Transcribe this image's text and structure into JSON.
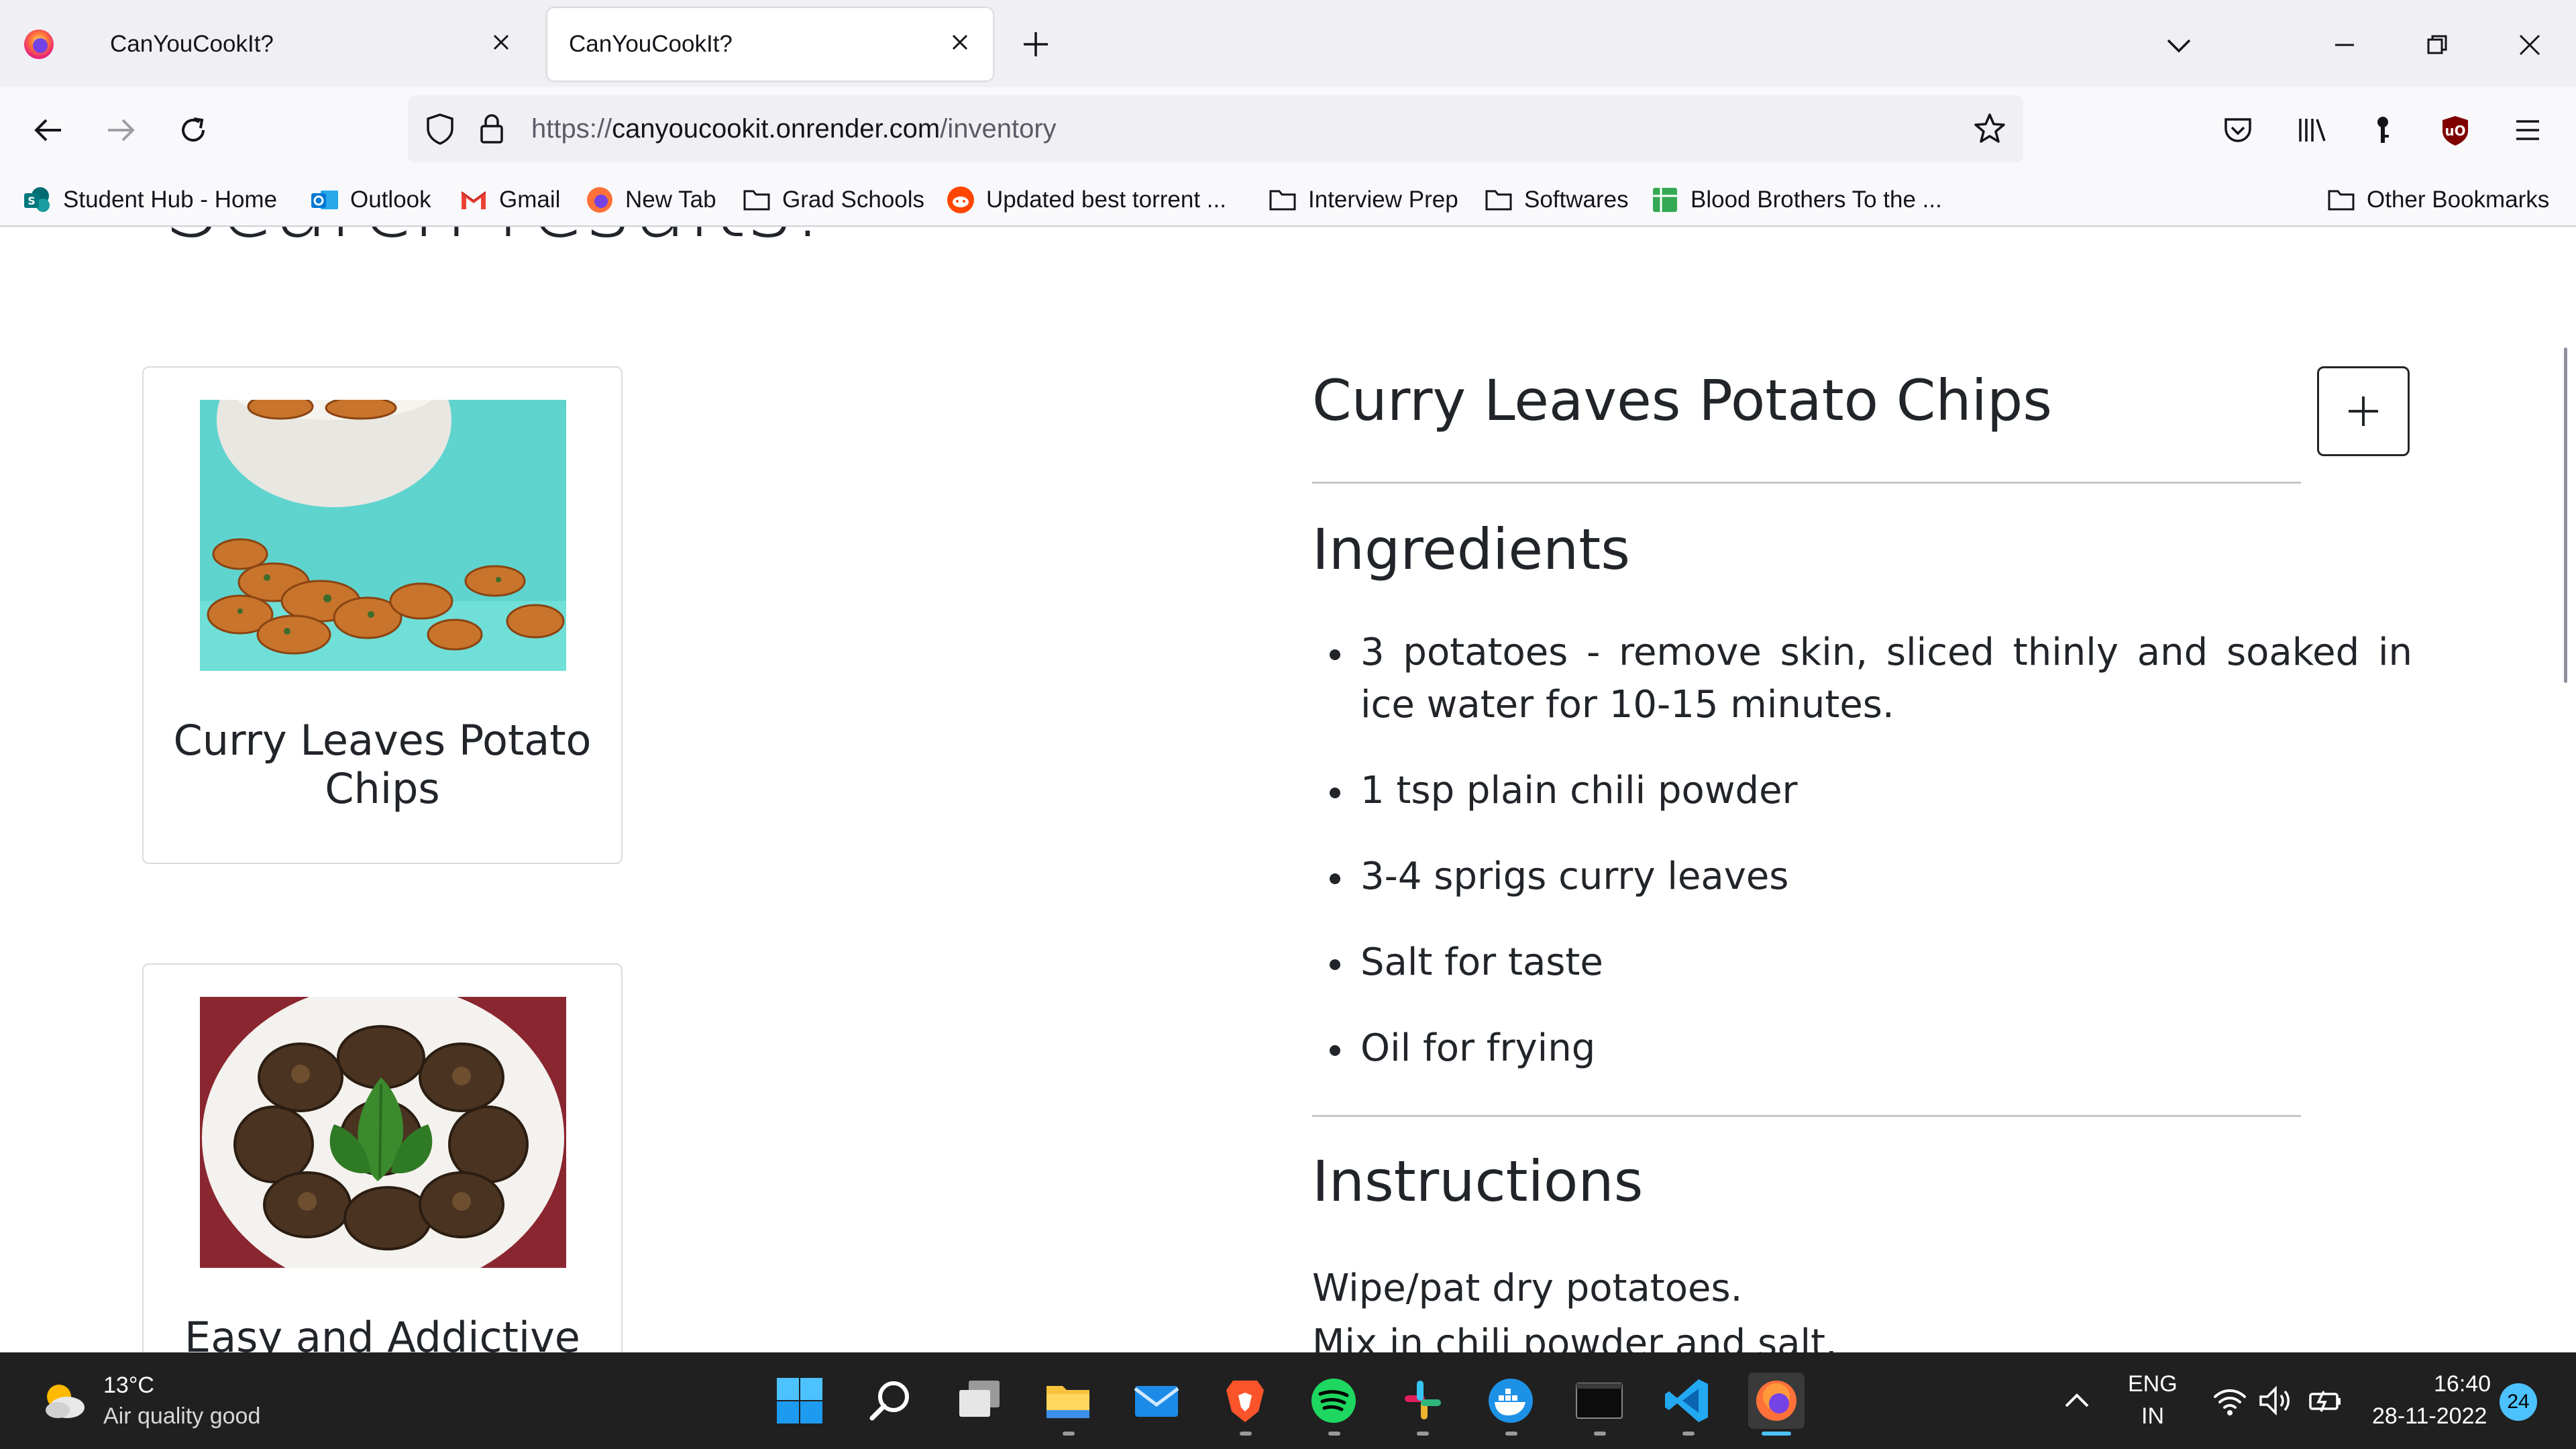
{
  "browser": {
    "tabs": [
      {
        "title": "CanYouCookIt?",
        "active": false
      },
      {
        "title": "CanYouCookIt?",
        "active": true
      }
    ],
    "url": {
      "scheme": "https://",
      "host": "canyoucookit.onrender.com",
      "path": "/inventory"
    },
    "bookmarks": [
      {
        "label": "Student Hub - Home",
        "icon": "sharepoint-icon"
      },
      {
        "label": "Outlook",
        "icon": "outlook-icon"
      },
      {
        "label": "Gmail",
        "icon": "gmail-icon"
      },
      {
        "label": "New Tab",
        "icon": "firefox-icon"
      },
      {
        "label": "Grad Schools",
        "icon": "folder-icon"
      },
      {
        "label": "Updated best torrent ...",
        "icon": "reddit-icon"
      },
      {
        "label": "Interview Prep",
        "icon": "folder-icon"
      },
      {
        "label": "Softwares",
        "icon": "folder-icon"
      },
      {
        "label": "Blood Brothers To the ...",
        "icon": "sheets-icon"
      }
    ],
    "other_bookmarks": "Other Bookmarks"
  },
  "page": {
    "heading": "Search results:",
    "results": [
      {
        "title": "Curry Leaves Potato Chips",
        "image": "potato-chips-photo"
      },
      {
        "title": "Easy and Addictive",
        "image": "fried-eggplant-photo"
      }
    ],
    "recipe": {
      "title": "Curry Leaves Potato Chips",
      "ingredients_heading": "Ingredients",
      "ingredients": [
        "3 potatoes - remove skin, sliced thinly and soaked in ice water for 10-15 minutes.",
        "1 tsp plain chili powder",
        "3-4 sprigs curry leaves",
        "Salt for taste",
        "Oil for frying"
      ],
      "instructions_heading": "Instructions",
      "instructions": [
        "Wipe/pat dry potatoes.",
        "Mix in chili powder and salt."
      ]
    }
  },
  "taskbar": {
    "weather": {
      "temp": "13°C",
      "status": "Air quality good"
    },
    "language": {
      "line1": "ENG",
      "line2": "IN"
    },
    "clock": {
      "time": "16:40",
      "date": "28-11-2022"
    },
    "notifications": "24"
  },
  "colors": {
    "taskbar": "#202020",
    "accent": "#4cc2ff",
    "page_text": "#212529"
  }
}
